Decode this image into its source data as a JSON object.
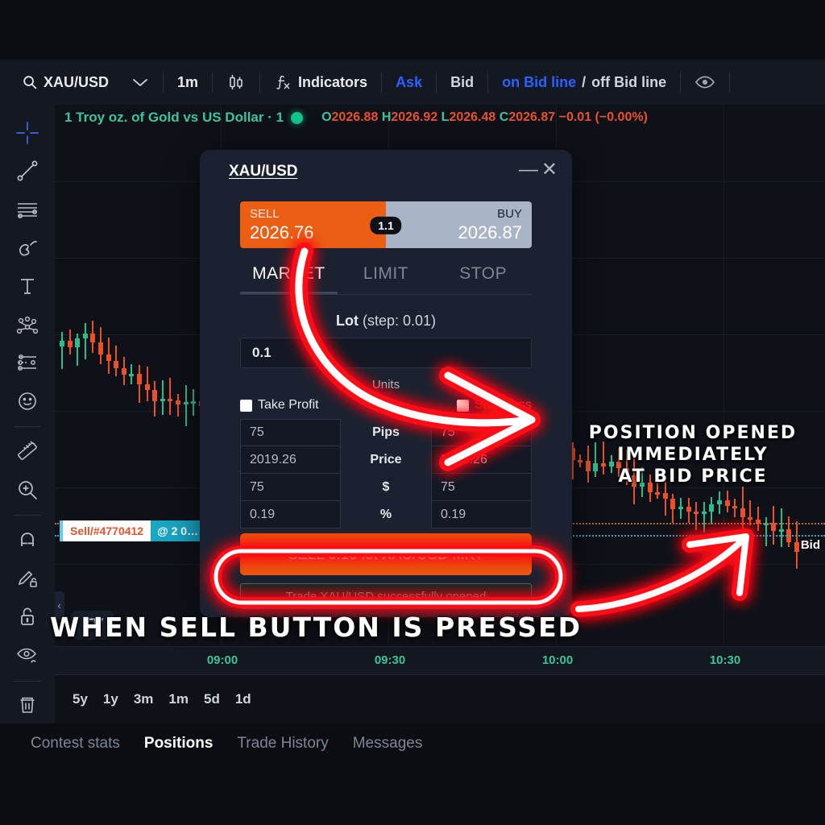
{
  "toolbar": {
    "search_icon": "search-icon",
    "symbol": "XAU/USD",
    "chevron": "▾",
    "timeframe": "1m",
    "chart_type_icon": "candlestick-icon",
    "fx_icon": "fx-icon",
    "indicators": "Indicators",
    "ask": "Ask",
    "bid": "Bid",
    "bidline_on": "on Bid line",
    "bidline_slash": "/",
    "bidline_off": "off Bid line",
    "eye_icon": "eye-icon",
    "accent_blue": "#2962ff"
  },
  "left_tools": [
    {
      "name": "crosshair-icon",
      "active": true
    },
    {
      "name": "trend-line-icon",
      "active": false
    },
    {
      "name": "horizontal-lines-icon",
      "active": false
    },
    {
      "name": "brush-icon",
      "active": false
    },
    {
      "name": "text-tool-icon",
      "active": false
    },
    {
      "name": "pattern-icon",
      "active": false
    },
    {
      "name": "forecast-icon",
      "active": false
    },
    {
      "name": "emoji-icon",
      "active": false
    },
    {
      "name": "ruler-icon",
      "active": false
    },
    {
      "name": "zoom-in-icon",
      "active": false
    },
    {
      "name": "magnet-icon",
      "active": false
    },
    {
      "name": "pencil-lock-icon",
      "active": false
    },
    {
      "name": "lock-icon",
      "active": false
    },
    {
      "name": "eye-hide-icon",
      "active": false
    },
    {
      "name": "trash-icon",
      "active": false
    }
  ],
  "chart": {
    "legend_symbol": "1 Troy oz. of Gold vs US Dollar · 1",
    "status_dot": "live-dot",
    "ohlc": [
      {
        "key": "O",
        "value": "2026.88"
      },
      {
        "key": "H",
        "value": "2026.92"
      },
      {
        "key": "L",
        "value": "2026.48"
      },
      {
        "key": "C",
        "value": "2026.87"
      }
    ],
    "change": "−0.01 (−0.00%)",
    "bid_label": "Bid",
    "position_tag": {
      "name": "Sell/#4770412",
      "price": "@ 2 0…"
    },
    "tv_logo": "TV",
    "time_labels": [
      "09:00",
      "09:30",
      "10:00",
      "10:30"
    ],
    "up_color": "#2bbd8a",
    "down_color": "#e8512a"
  },
  "timeframes": [
    "5y",
    "1y",
    "3m",
    "1m",
    "5d",
    "1d"
  ],
  "bottom_tabs": [
    {
      "label": "Contest stats",
      "active": false
    },
    {
      "label": "Positions",
      "active": true
    },
    {
      "label": "Trade History",
      "active": false
    },
    {
      "label": "Messages",
      "active": false
    }
  ],
  "order_panel": {
    "title": "XAU/USD",
    "minimize_icon": "minimize-icon",
    "close_icon": "close-icon",
    "sell_label": "SELL",
    "sell_price": "2026.76",
    "buy_label": "BUY",
    "buy_price": "2026.87",
    "spread": "1.1",
    "tabs": [
      {
        "label": "MARKET",
        "active": true
      },
      {
        "label": "LIMIT",
        "active": false
      },
      {
        "label": "STOP",
        "active": false
      }
    ],
    "lot_label": "Lot",
    "lot_step": "(step: 0.01)",
    "lot_value": "0.1",
    "units_label": "Units",
    "take_profit_label": "Take Profit",
    "stop_loss_label": "Stop Loss",
    "rows": [
      {
        "tp": "75",
        "unit": "Pips",
        "sl": "75"
      },
      {
        "tp": "2019.26",
        "unit": "Price",
        "sl": "2034.26"
      },
      {
        "tp": "75",
        "unit": "$",
        "sl": "75"
      },
      {
        "tp": "0.19",
        "unit": "%",
        "sl": "0.19"
      }
    ],
    "submit_label": "SELL 0.10 lot XAU/USD MKT",
    "toast": "Trade XAU/USD successfully opened",
    "sell_color": "#e8540f",
    "buy_color": "#a9b4c6"
  },
  "annotations": {
    "right_text": "POSITION OPENED\nIMMEDIATELY\nAT BID PRICE",
    "bottom_text": "WHEN SELL BUTTON IS PRESSED",
    "neon_color": "#ff0f16"
  }
}
